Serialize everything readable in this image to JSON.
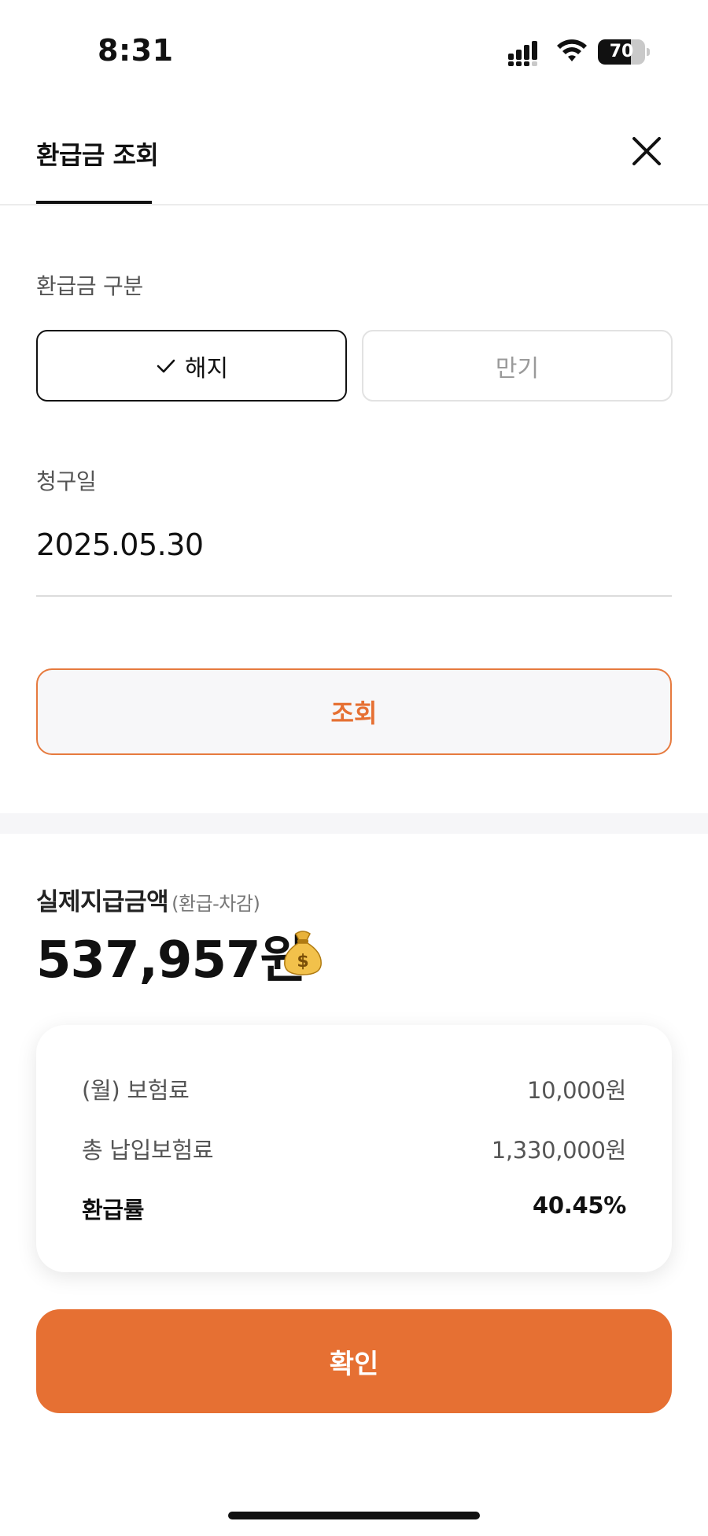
{
  "status_bar": {
    "time": "8:31",
    "battery": "70",
    "battery_level": 0.7
  },
  "header": {
    "title": "환급금 조회",
    "close_icon": "close-icon"
  },
  "refund_type": {
    "label": "환급금 구분",
    "options": [
      {
        "label": "해지",
        "selected": true
      },
      {
        "label": "만기",
        "selected": false
      }
    ]
  },
  "claim_date": {
    "label": "청구일",
    "value": "2025.05.30"
  },
  "query_button": {
    "label": "조회"
  },
  "result": {
    "label": "실제지급금액",
    "sublabel": "(환급-차감)",
    "amount": "537,957원",
    "icon": "moneybag-icon"
  },
  "details": {
    "rows": [
      {
        "label": "(월) 보험료",
        "value": "10,000원"
      },
      {
        "label": "총 납입보험료",
        "value": "1,330,000원"
      },
      {
        "label": "환급률",
        "value": "40.45%"
      }
    ]
  },
  "confirm_button": {
    "label": "확인"
  },
  "colors": {
    "accent": "#e67033",
    "accent_border": "#e67a3e",
    "text": "#111111",
    "muted": "#9a9a9a"
  }
}
